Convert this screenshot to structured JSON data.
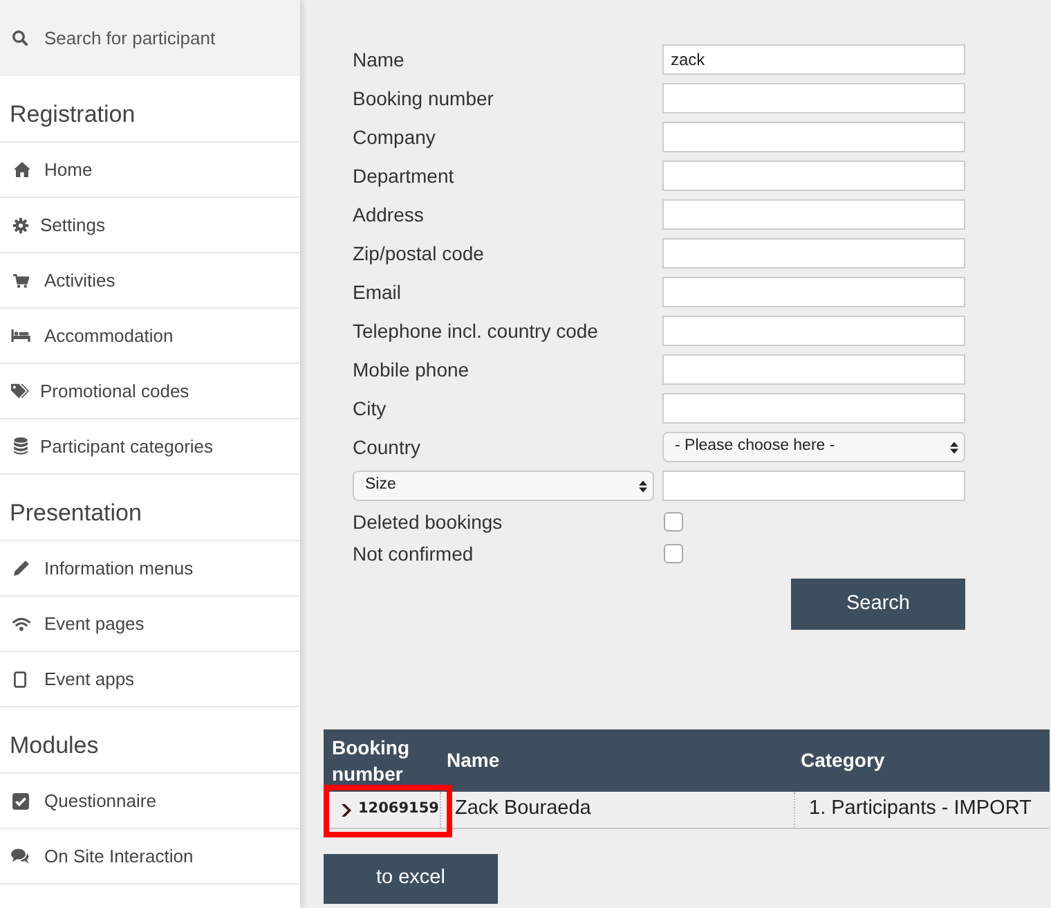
{
  "sidebar": {
    "search": {
      "placeholder": "Search for participant"
    },
    "sections": [
      {
        "heading": "Registration",
        "items": [
          "Home",
          "Settings",
          "Activities",
          "Accommodation",
          "Promotional codes",
          "Participant categories"
        ]
      },
      {
        "heading": "Presentation",
        "items": [
          "Information menus",
          "Event pages",
          "Event apps"
        ]
      },
      {
        "heading": "Modules",
        "items": [
          "Questionnaire",
          "On Site Interaction"
        ]
      }
    ]
  },
  "search_form": {
    "fields": [
      {
        "kind": "text",
        "label": "Name",
        "value": "zack"
      },
      {
        "kind": "text",
        "label": "Booking number"
      },
      {
        "kind": "text",
        "label": "Company"
      },
      {
        "kind": "text",
        "label": "Department"
      },
      {
        "kind": "text",
        "label": "Address"
      },
      {
        "kind": "text",
        "label": "Zip/postal code"
      },
      {
        "kind": "text",
        "label": "Email"
      },
      {
        "kind": "text",
        "label": "Telephone incl. country code"
      },
      {
        "kind": "text",
        "label": "Mobile phone"
      },
      {
        "kind": "text",
        "label": "City"
      },
      {
        "kind": "select",
        "label": "Country",
        "value": "- Please choose here -"
      },
      {
        "kind": "select_text",
        "select": "Size"
      },
      {
        "kind": "checkbox",
        "label": "Deleted bookings",
        "checked": false
      },
      {
        "kind": "checkbox",
        "label": "Not confirmed",
        "checked": false
      }
    ],
    "search_button": "Search"
  },
  "results": {
    "columns": [
      "Booking number",
      "Name",
      "Category"
    ],
    "rows": [
      {
        "booking_number": "12069159",
        "name": "Zack Bouraeda",
        "category": "1. Participants - IMPORT",
        "highlighted": true
      }
    ]
  },
  "export_button": "to excel"
}
